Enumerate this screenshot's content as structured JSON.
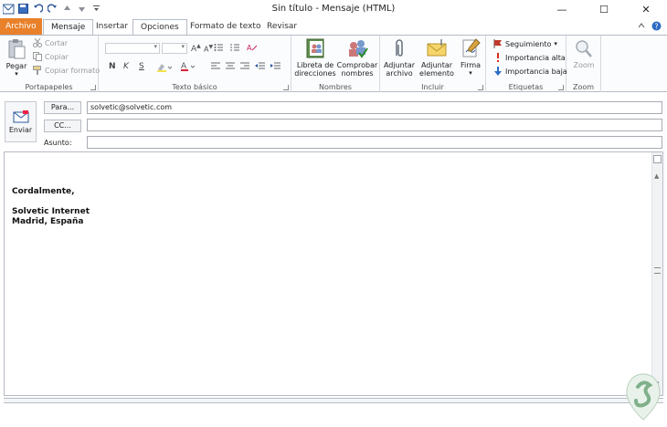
{
  "window": {
    "title": "Sin título  -  Mensaje (HTML)",
    "minimize": "—",
    "maximize": "☐",
    "close": "✕"
  },
  "tabs": [
    {
      "label": "Archivo"
    },
    {
      "label": "Mensaje"
    },
    {
      "label": "Insertar"
    },
    {
      "label": "Opciones"
    },
    {
      "label": "Formato de texto"
    },
    {
      "label": "Revisar"
    }
  ],
  "ribbon": {
    "clipboard": {
      "label": "Portapapeles",
      "paste": "Pegar",
      "cut": "Cortar",
      "copy": "Copiar",
      "format_painter": "Copiar formato"
    },
    "basic_text": {
      "label": "Texto básico",
      "bold": "N",
      "italic": "K",
      "underline": "S"
    },
    "names": {
      "label": "Nombres",
      "address_book": "Libreta de\ndirecciones",
      "check_names": "Comprobar\nnombres"
    },
    "include": {
      "label": "Incluir",
      "attach_file": "Adjuntar\narchivo",
      "attach_item": "Adjuntar\nelemento",
      "signature": "Firma"
    },
    "tags": {
      "label": "Etiquetas",
      "follow_up": "Seguimiento",
      "high_importance": "Importancia alta",
      "low_importance": "Importancia baja"
    },
    "zoom": {
      "label": "Zoom",
      "zoom": "Zoom"
    }
  },
  "header": {
    "send": "Enviar",
    "to_button": "Para...",
    "cc_button": "CC...",
    "subject_label": "Asunto:",
    "to_value": "solvetic@solvetic.com",
    "cc_value": "",
    "subject_value": ""
  },
  "body": {
    "lines": [
      "Cordalmente,",
      "",
      "Solvetic Internet",
      "Madrid, España"
    ]
  },
  "colors": {
    "file_tab": "#e9802a",
    "accent": "#2b579a"
  }
}
